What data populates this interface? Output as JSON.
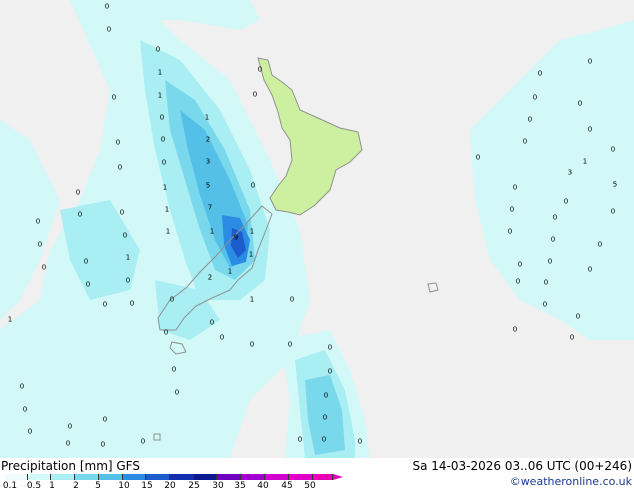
{
  "map": {
    "values": [
      "0",
      "0",
      "0",
      "1",
      "1",
      "0",
      "1",
      "0",
      "2",
      "0",
      "0",
      "3",
      "0",
      "5",
      "0",
      "1",
      "7",
      "0",
      "1",
      "1",
      "1",
      "9",
      "1",
      "0",
      "2",
      "1",
      "1",
      "1",
      "1",
      "0",
      "0",
      "0",
      "0",
      "0",
      "0",
      "0",
      "0",
      "0",
      "0",
      "0",
      "0",
      "0",
      "0",
      "0",
      "0",
      "0",
      "0",
      "0",
      "0",
      "1",
      "0",
      "0",
      "0",
      "0",
      "0",
      "0",
      "0",
      "0",
      "0",
      "0",
      "0",
      "0",
      "0",
      "0",
      "0",
      "0",
      "1",
      "3",
      "5",
      "0",
      "0",
      "0",
      "0",
      "0",
      "0",
      "0",
      "0",
      "0",
      "0",
      "0",
      "0",
      "0",
      "0",
      "0",
      "0",
      "0",
      "0",
      "0",
      "0",
      "0",
      "0",
      "0",
      "0",
      "0",
      "0",
      "0"
    ],
    "colors": {
      "sea": "#f0f0f0",
      "land": "#ccf0a0",
      "coast": "#909090",
      "precip_0_1": "#d2f8f8",
      "precip_1": "#a8eef2",
      "precip_2": "#7ad8ec",
      "precip_5": "#54c0e8",
      "precip_10": "#2c8ce4",
      "precip_15": "#1c5ccc"
    }
  },
  "footer": {
    "title": "Precipitation [mm] GFS",
    "datetime": "Sa 14-03-2026 03..06 UTC (00+246)",
    "credit": "©weatheronline.co.uk"
  },
  "legend": {
    "ticks": [
      "0.1",
      "0.5",
      "1",
      "2",
      "5",
      "10",
      "15",
      "20",
      "25",
      "30",
      "35",
      "40",
      "45",
      "50"
    ],
    "colors": [
      "#f0fcfc",
      "#d2f8f8",
      "#a8eef2",
      "#7ad8ec",
      "#54c0e8",
      "#2c8ce4",
      "#1c5ccc",
      "#1030b0",
      "#0a1a90",
      "#7000c0",
      "#a000d0",
      "#d000d0",
      "#e000c8",
      "#e800b8"
    ]
  }
}
